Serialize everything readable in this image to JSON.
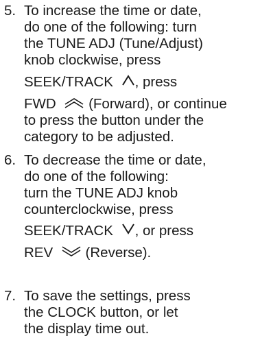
{
  "steps": [
    {
      "number": "5.",
      "lines": [
        "To increase the time or date,",
        "do one of the following: turn",
        "the TUNE ADJ (Tune/Adjust)",
        "knob clockwise, press",
        "SEEK/TRACK",
        "FWD",
        " (Forward), or continue",
        "to press the button under the",
        "category to be adjusted."
      ]
    },
    {
      "number": "6.",
      "lines": [
        "To decrease the time or date,",
        "do one of the following:",
        "turn the TUNE ADJ knob",
        "counterclockwise, press",
        "SEEK/TRACK",
        ", or press",
        "REV",
        " (Reverse)."
      ]
    },
    {
      "number": "7.",
      "lines": [
        "To save the settings, press",
        "the CLOCK button, or let",
        "the display time out."
      ]
    }
  ],
  "icons": {
    "seek_up": "chevron-up-icon",
    "forward": "double-chevron-up-icon",
    "seek_down": "chevron-down-icon",
    "reverse": "double-chevron-down-icon"
  },
  "text_color": "#1a1a1a"
}
